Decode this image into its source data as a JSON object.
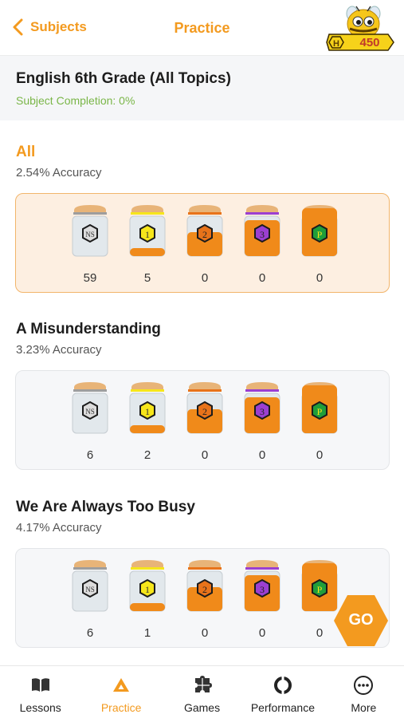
{
  "header": {
    "back_label": "Subjects",
    "title": "Practice",
    "hive_letter": "H",
    "hive_points": "450"
  },
  "subject": {
    "title": "English 6th Grade (All Topics)",
    "completion": "Subject Completion: 0%"
  },
  "jar_labels": [
    "NS",
    "1",
    "2",
    "3",
    "P"
  ],
  "colors": {
    "accent": "#f39a1f",
    "completion_green": "#7ab648",
    "active_card_bg": "#fdefe1",
    "honey": "#f08a1a",
    "level_ns": "#9e9e9e",
    "level_1": "#f6e61b",
    "level_2": "#e8731a",
    "level_3": "#9b3fd1",
    "level_p": "#1f9e3a"
  },
  "topics": [
    {
      "title": "All",
      "accuracy": "2.54% Accuracy",
      "counts": [
        "59",
        "5",
        "0",
        "0",
        "0"
      ]
    },
    {
      "title": "A Misunderstanding",
      "accuracy": "3.23% Accuracy",
      "counts": [
        "6",
        "2",
        "0",
        "0",
        "0"
      ]
    },
    {
      "title": "We Are Always Too Busy",
      "accuracy": "4.17% Accuracy",
      "counts": [
        "6",
        "1",
        "0",
        "0",
        "0"
      ]
    }
  ],
  "go_label": "GO",
  "nav": [
    {
      "label": "Lessons",
      "icon": "book-icon"
    },
    {
      "label": "Practice",
      "icon": "practice-triangle-icon"
    },
    {
      "label": "Games",
      "icon": "puzzle-icon"
    },
    {
      "label": "Performance",
      "icon": "performance-icon"
    },
    {
      "label": "More",
      "icon": "more-dots-icon"
    }
  ]
}
